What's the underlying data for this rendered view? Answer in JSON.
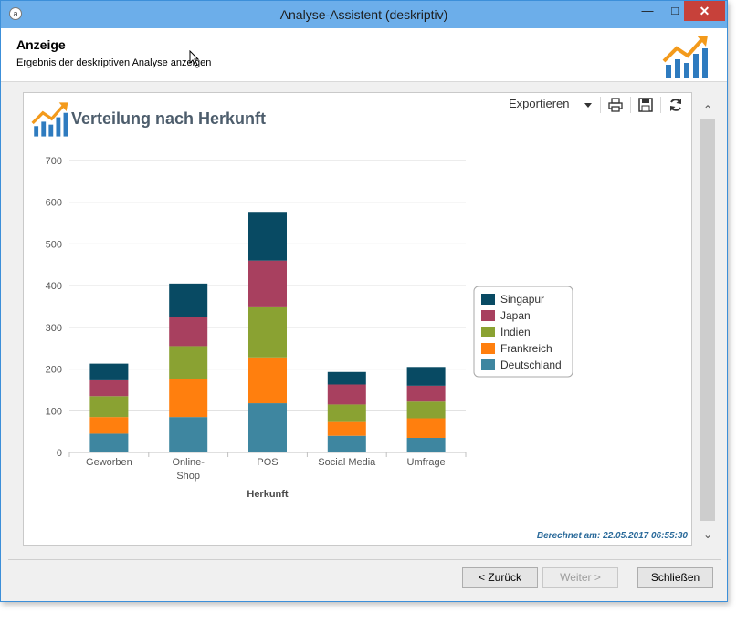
{
  "window": {
    "title": "Analyse-Assistent (deskriptiv)",
    "minimize_symbol": "—",
    "maximize_symbol": "□",
    "close_symbol": "✕"
  },
  "header": {
    "title": "Anzeige",
    "subtitle": "Ergebnis der deskriptiven Analyse anzeigen"
  },
  "toolbar": {
    "export_label": "Exportieren",
    "icons": [
      "print-icon",
      "save-icon",
      "refresh-icon"
    ]
  },
  "chart_panel": {
    "computed_label": "Berechnet am: 22.05.2017 06:55:30"
  },
  "chart_data": {
    "type": "bar",
    "stacked": true,
    "title": "Verteilung nach Herkunft",
    "xlabel": "Herkunft",
    "ylabel": "",
    "ylim": [
      0,
      700
    ],
    "yticks": [
      0,
      100,
      200,
      300,
      400,
      500,
      600,
      700
    ],
    "categories": [
      "Geworben",
      "Online-Shop",
      "POS",
      "Social Media",
      "Umfrage"
    ],
    "category_lines": [
      [
        "Geworben"
      ],
      [
        "Online-",
        "Shop"
      ],
      [
        "POS"
      ],
      [
        "Social Media"
      ],
      [
        "Umfrage"
      ]
    ],
    "series": [
      {
        "name": "Deutschland",
        "color": "#3e86a0",
        "values": [
          45,
          85,
          118,
          40,
          35
        ]
      },
      {
        "name": "Frankreich",
        "color": "#ff7f0e",
        "values": [
          40,
          90,
          110,
          33,
          47
        ]
      },
      {
        "name": "Indien",
        "color": "#8aa232",
        "values": [
          50,
          80,
          120,
          42,
          40
        ]
      },
      {
        "name": "Japan",
        "color": "#a8405f",
        "values": [
          38,
          70,
          112,
          48,
          38
        ]
      },
      {
        "name": "Singapur",
        "color": "#084a63",
        "values": [
          40,
          80,
          117,
          30,
          45
        ]
      }
    ],
    "legend_order": [
      "Singapur",
      "Japan",
      "Indien",
      "Frankreich",
      "Deutschland"
    ],
    "legend_position": "right",
    "grid": true
  },
  "buttons": {
    "back": "< Zurück",
    "next": "Weiter >",
    "close": "Schließen"
  },
  "scroll": {
    "up": "⌃",
    "down": "⌄"
  }
}
